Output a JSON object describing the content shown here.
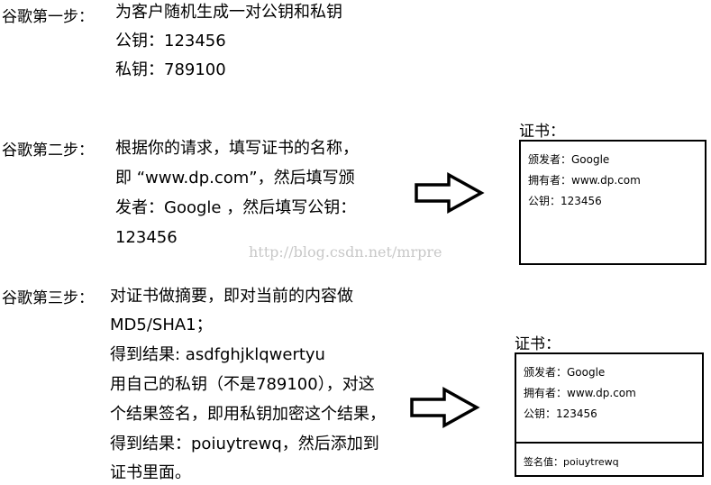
{
  "step1": {
    "label": "谷歌第一步：",
    "lines": [
      "为客户随机生成一对公钥和私钥",
      "公钥：123456",
      "私钥：789100"
    ]
  },
  "step2": {
    "label": "谷歌第二步：",
    "lines": [
      "根据你的请求，填写证书的名称，",
      "即 “www.dp.com”，然后填写颁",
      "发者：Google ，然后填写公钥：",
      "123456"
    ],
    "certificate": {
      "title": "证书：",
      "lines": [
        "颁发者：Google",
        "拥有者：www.dp.com",
        "公钥：123456"
      ]
    }
  },
  "step3": {
    "label": "谷歌第三步：",
    "lines": [
      "对证书做摘要，即对当前的内容做",
      "MD5/SHA1；",
      "得到结果: asdfghjklqwertyu",
      "用自己的私钥（不是789100），对这",
      "个结果签名，即用私钥加密这个结果，",
      "得到结果：poiuytrewq，然后添加到",
      "证书里面。"
    ],
    "certificate": {
      "title": "证书：",
      "lines": [
        "颁发者：Google",
        "拥有者：www.dp.com",
        "公钥：123456"
      ],
      "signature": "签名值：poiuytrewq"
    }
  },
  "watermark": "http://blog.csdn.net/mrpre",
  "colors": {
    "ink": "#000000",
    "background": "#ffffff",
    "watermark": "#c8c8c8"
  },
  "icons": [
    "right-arrow-icon",
    "right-arrow-icon"
  ]
}
